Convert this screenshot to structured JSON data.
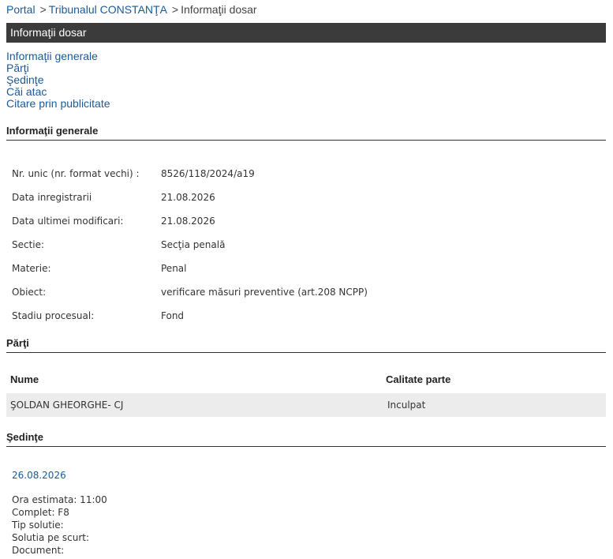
{
  "breadcrumb": {
    "portal": "Portal",
    "court": "Tribunalul CONSTANŢA",
    "separator": ">",
    "current": "Informaţii dosar"
  },
  "title_bar": "Informaţii dosar",
  "nav": {
    "items": [
      "Informaţii generale",
      "Părţi",
      "Şedinţe",
      "Căi atac",
      "Citare prin publicitate"
    ]
  },
  "general": {
    "title": "Informaţii generale",
    "rows": [
      {
        "label": "Nr. unic (nr. format vechi) :",
        "value": "8526/118/2024/a19"
      },
      {
        "label": "Data inregistrarii",
        "value": "21.08.2026"
      },
      {
        "label": "Data ultimei modificari:",
        "value": "21.08.2026"
      },
      {
        "label": "Sectie:",
        "value": "Secţia penală"
      },
      {
        "label": "Materie:",
        "value": "Penal"
      },
      {
        "label": "Obiect:",
        "value": "verificare măsuri preventive (art.208 NCPP)"
      },
      {
        "label": "Stadiu procesual:",
        "value": "Fond"
      }
    ]
  },
  "parties": {
    "title": "Părţi",
    "headers": {
      "name": "Nume",
      "role": "Calitate parte"
    },
    "rows": [
      {
        "name": "ŞOLDAN GHEORGHE- CJ",
        "role": "Inculpat"
      }
    ]
  },
  "hearings": {
    "title": "Şedinţe",
    "date": "26.08.2026",
    "details": [
      "Ora estimata: 11:00",
      "Complet: F8",
      "Tip solutie:",
      "Solutia pe scurt:",
      "Document:"
    ]
  },
  "colors": {
    "link": "#1a5a9a",
    "title_bar_bg": "#3b3b3b",
    "row_bg": "#ececec"
  }
}
